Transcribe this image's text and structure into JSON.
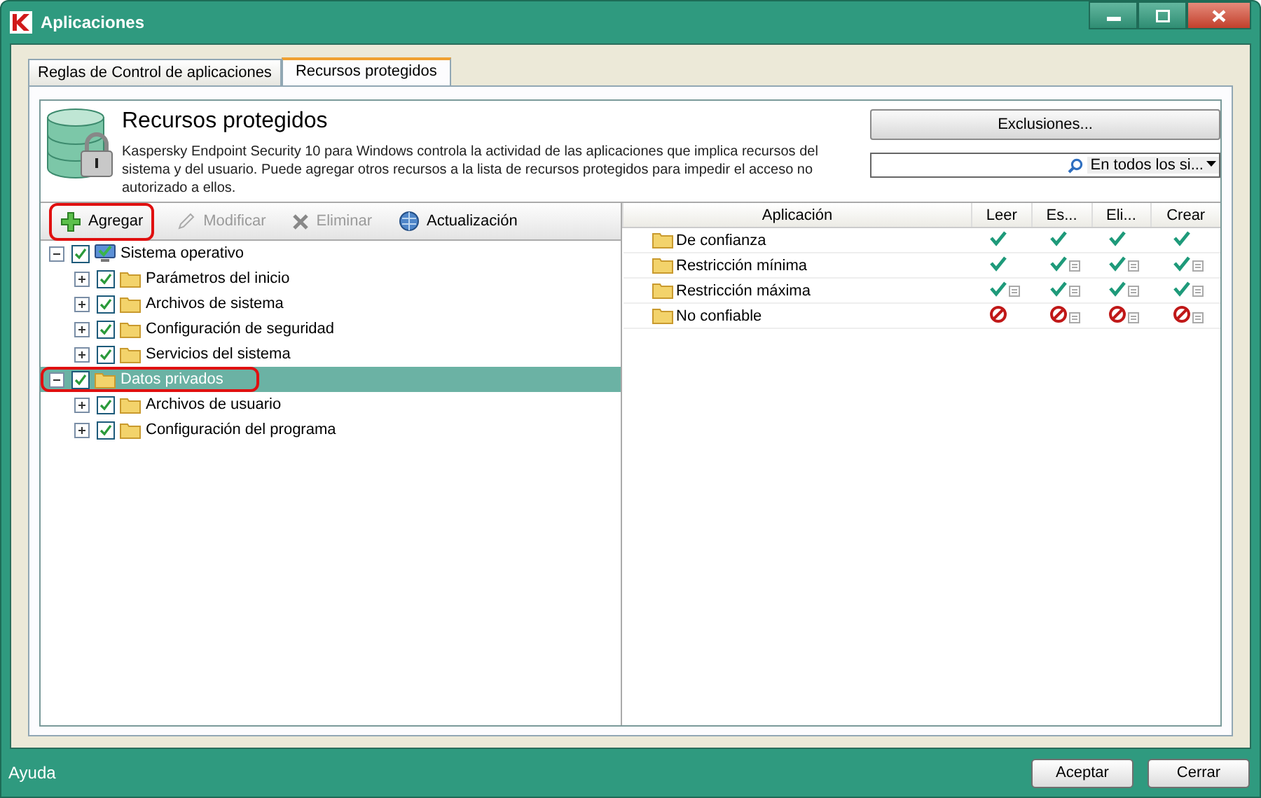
{
  "window": {
    "title": "Aplicaciones"
  },
  "tabs": [
    {
      "label": "Reglas de Control de aplicaciones",
      "selected": false
    },
    {
      "label": "Recursos protegidos",
      "selected": true
    }
  ],
  "header": {
    "title": "Recursos protegidos",
    "description": "Kaspersky Endpoint Security 10 para Windows controla la actividad de las aplicaciones que implica recursos del sistema y del usuario. Puede agregar otros recursos a la lista de recursos protegidos para impedir el acceso no autorizado a ellos.",
    "exclusions_button": "Exclusiones...",
    "search": {
      "scope": "En todos los si..."
    }
  },
  "toolbar": [
    {
      "kind": "add",
      "label": "Agregar",
      "disabled": false,
      "highlighted": true
    },
    {
      "kind": "edit",
      "label": "Modificar",
      "disabled": true,
      "highlighted": false
    },
    {
      "kind": "delete",
      "label": "Eliminar",
      "disabled": true,
      "highlighted": false
    },
    {
      "kind": "update",
      "label": "Actualización",
      "disabled": false,
      "highlighted": false
    }
  ],
  "tree": [
    {
      "kind": "system",
      "label": "Sistema operativo",
      "expanded": true,
      "checked": true,
      "selected": false,
      "highlighted": false,
      "children": [
        {
          "kind": "folder",
          "label": "Parámetros del inicio",
          "expanded": false,
          "checked": true,
          "selected": false,
          "highlighted": false
        },
        {
          "kind": "folder",
          "label": "Archivos de sistema",
          "expanded": false,
          "checked": true,
          "selected": false,
          "highlighted": false
        },
        {
          "kind": "folder",
          "label": "Configuración de seguridad",
          "expanded": false,
          "checked": true,
          "selected": false,
          "highlighted": false
        },
        {
          "kind": "folder",
          "label": "Servicios del sistema",
          "expanded": false,
          "checked": true,
          "selected": false,
          "highlighted": false
        }
      ]
    },
    {
      "kind": "folder",
      "label": "Datos privados",
      "expanded": true,
      "checked": true,
      "selected": true,
      "highlighted": true,
      "children": [
        {
          "kind": "folder",
          "label": "Archivos de usuario",
          "expanded": false,
          "checked": true,
          "selected": false,
          "highlighted": false
        },
        {
          "kind": "folder",
          "label": "Configuración del programa",
          "expanded": false,
          "checked": true,
          "selected": false,
          "highlighted": false
        }
      ]
    }
  ],
  "table": {
    "columns": [
      "Aplicación",
      "Leer",
      "Es...",
      "Eli...",
      "Crear"
    ],
    "rows": [
      {
        "group": "De confianza",
        "cells": [
          {
            "kind": "allow",
            "note": false
          },
          {
            "kind": "allow",
            "note": false
          },
          {
            "kind": "allow",
            "note": false
          },
          {
            "kind": "allow",
            "note": false
          }
        ]
      },
      {
        "group": "Restricción mínima",
        "cells": [
          {
            "kind": "allow",
            "note": false
          },
          {
            "kind": "allow",
            "note": true
          },
          {
            "kind": "allow",
            "note": true
          },
          {
            "kind": "allow",
            "note": true
          }
        ]
      },
      {
        "group": "Restricción máxima",
        "cells": [
          {
            "kind": "allow",
            "note": true
          },
          {
            "kind": "allow",
            "note": true
          },
          {
            "kind": "allow",
            "note": true
          },
          {
            "kind": "allow",
            "note": true
          }
        ]
      },
      {
        "group": "No confiable",
        "cells": [
          {
            "kind": "deny",
            "note": false
          },
          {
            "kind": "deny",
            "note": true
          },
          {
            "kind": "deny",
            "note": true
          },
          {
            "kind": "deny",
            "note": true
          }
        ]
      }
    ]
  },
  "footer": {
    "help": "Ayuda",
    "buttons": [
      "Aceptar",
      "Cerrar"
    ]
  }
}
